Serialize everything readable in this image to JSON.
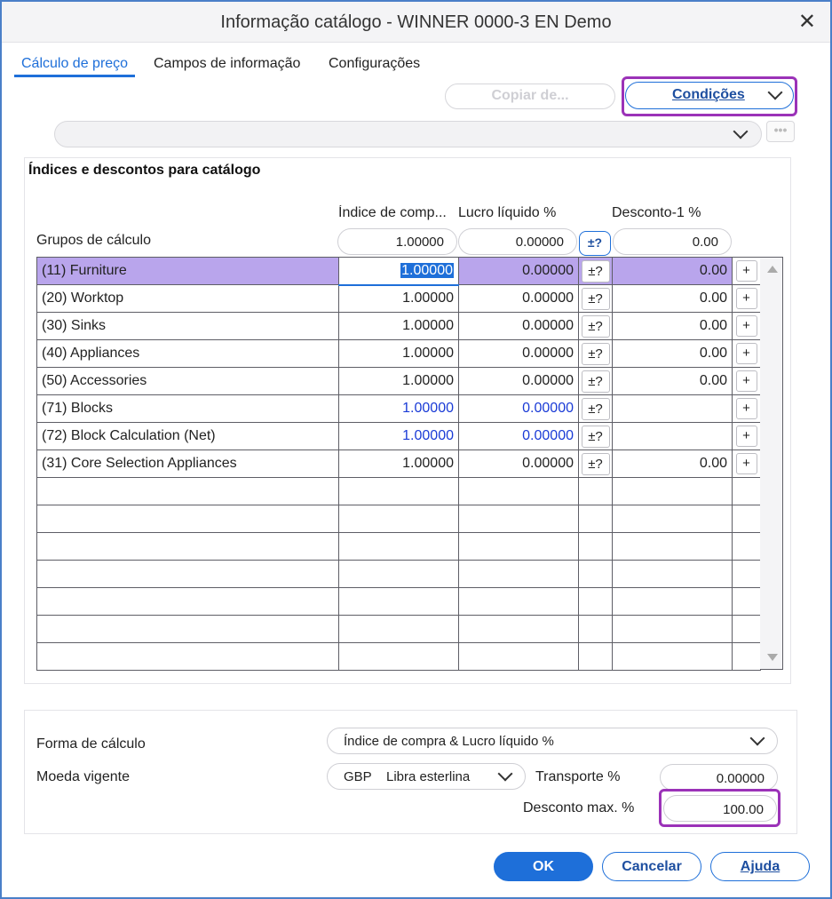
{
  "window": {
    "title": "Informação catálogo - WINNER 0000-3 EN Demo"
  },
  "tabs": [
    {
      "label": "Cálculo de preço",
      "active": true
    },
    {
      "label": "Campos de informação",
      "active": false
    },
    {
      "label": "Configurações",
      "active": false
    }
  ],
  "toolbar": {
    "copy_label": "Copiar de...",
    "conditions_label": "Condições"
  },
  "filter": {
    "value": "",
    "dots_label": "•••"
  },
  "panel": {
    "title": "Índices e descontos para catálogo",
    "group_label": "Grupos de cálculo",
    "columns": {
      "indice": "Índice de comp...",
      "lucro": "Lucro líquido %",
      "desconto": "Desconto-1 %"
    },
    "header_values": {
      "indice": "1.00000",
      "lucro": "0.00000",
      "pm": "±?",
      "desconto": "0.00"
    }
  },
  "rows": [
    {
      "name": "(11) Furniture",
      "indice": "1.00000",
      "lucro": "0.00000",
      "pm": "±?",
      "desconto": "0.00",
      "plus": "+",
      "selected": true,
      "blue": false
    },
    {
      "name": "(20) Worktop",
      "indice": "1.00000",
      "lucro": "0.00000",
      "pm": "±?",
      "desconto": "0.00",
      "plus": "+",
      "selected": false,
      "blue": false
    },
    {
      "name": "(30) Sinks",
      "indice": "1.00000",
      "lucro": "0.00000",
      "pm": "±?",
      "desconto": "0.00",
      "plus": "+",
      "selected": false,
      "blue": false
    },
    {
      "name": "(40) Appliances",
      "indice": "1.00000",
      "lucro": "0.00000",
      "pm": "±?",
      "desconto": "0.00",
      "plus": "+",
      "selected": false,
      "blue": false
    },
    {
      "name": "(50) Accessories",
      "indice": "1.00000",
      "lucro": "0.00000",
      "pm": "±?",
      "desconto": "0.00",
      "plus": "+",
      "selected": false,
      "blue": false
    },
    {
      "name": "(71) Blocks",
      "indice": "1.00000",
      "lucro": "0.00000",
      "pm": "±?",
      "desconto": "",
      "plus": "+",
      "selected": false,
      "blue": true
    },
    {
      "name": "(72) Block Calculation (Net)",
      "indice": "1.00000",
      "lucro": "0.00000",
      "pm": "±?",
      "desconto": "",
      "plus": "+",
      "selected": false,
      "blue": true
    },
    {
      "name": "(31) Core Selection Appliances",
      "indice": "1.00000",
      "lucro": "0.00000",
      "pm": "±?",
      "desconto": "0.00",
      "plus": "+",
      "selected": false,
      "blue": false
    }
  ],
  "empty_rows": 7,
  "bottom": {
    "forma_label": "Forma de cálculo",
    "forma_value": "Índice de compra & Lucro líquido %",
    "moeda_label": "Moeda vigente",
    "moeda_code": "GBP",
    "moeda_name": "Libra esterlina",
    "transporte_label": "Transporte %",
    "transporte_value": "0.00000",
    "desconto_max_label": "Desconto max. %",
    "desconto_max_value": "100.00"
  },
  "footer": {
    "ok": "OK",
    "cancel": "Cancelar",
    "help": "Ajuda"
  },
  "colors": {
    "accent": "#1e6fd9",
    "selection": "#b9a5ec",
    "highlight": "#9b32b8",
    "blue_text": "#1a3bd6"
  }
}
